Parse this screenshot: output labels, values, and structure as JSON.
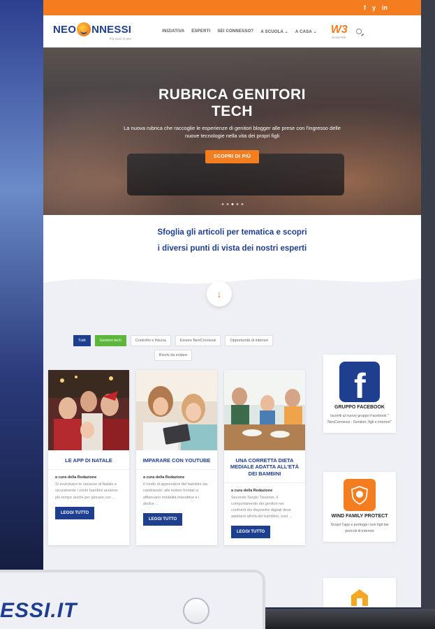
{
  "topbar": {
    "social": [
      "f",
      "y",
      "in"
    ]
  },
  "header": {
    "logo_prefix": "NEO",
    "logo_suffix": "NNESSI",
    "logo_tagline": "Più vicini in rete",
    "nav": [
      "INIZIATIVA",
      "ESPERTI",
      "SEI CONNESSO?",
      "A SCUOLA ⌄",
      "A CASA ⌄"
    ],
    "partner_mark": "W3",
    "partner_name": "WINDTRE"
  },
  "hero": {
    "title_line1": "RUBRICA GENITORI",
    "title_line2": "TECH",
    "subtitle": "La nuova rubrica che raccoglie le esperienze di genitori blogger alle prese con l'ingresso  delle nuove tecnologie nella vita dei propri figli",
    "cta": "SCOPRI DI PIÙ",
    "slides": 5,
    "active_slide": 2
  },
  "intro": {
    "line1": "Sfoglia gli articoli per tematica e scopri",
    "line2": "i diversi punti di vista dei nostri esperti"
  },
  "filters": [
    "Tutti",
    "Genitori tech",
    "Controllo e fiducia",
    "Essere NeoConnessi",
    "Opportunità di internet",
    "Rischi da evitare"
  ],
  "cards": [
    {
      "title": "LE APP DI NATALE",
      "author": "a cura della Redazione",
      "text": "Si avvicinano le vacanze di Natale e sicuramente i vostri bambini avranno più tempo anche per giocare con ...",
      "cta": "LEGGI TUTTO"
    },
    {
      "title": "IMPARARE CON YOUTUBE",
      "author": "a cura della Redazione",
      "text": "Il modo di apprendere dei bambini sta cambiando: alle lezioni frontali si affiancano modalità interattive e i device ...",
      "cta": "LEGGI TUTTO"
    },
    {
      "title": "UNA CORRETTA DIETA MEDIALE ADATTA ALL'ETÀ DEI BAMBINI",
      "author": "a cura della Redazione",
      "text": "Secondo Sergio Tisseron, il comportamento dei genitori nei confronti dei dispositivi digitali deve adattarsi all'età del bambino, così ...",
      "cta": "LEGGI TUTTO"
    }
  ],
  "sidebar": [
    {
      "title": "GRUPPO FACEBOOK",
      "text": "Iscriviti al nuovo gruppo Facebook \" NeoConnessi - Genitori, figli e internet\""
    },
    {
      "title": "WIND FAMILY PROTECT",
      "text": "Scopri l'app e proteggi i tuoi figli dai pericoli di internet"
    }
  ],
  "overlay": {
    "url": "ESSI.IT"
  },
  "colors": {
    "brand_blue": "#1e3e8f",
    "brand_orange": "#f47d20",
    "green": "#5cb63b"
  }
}
